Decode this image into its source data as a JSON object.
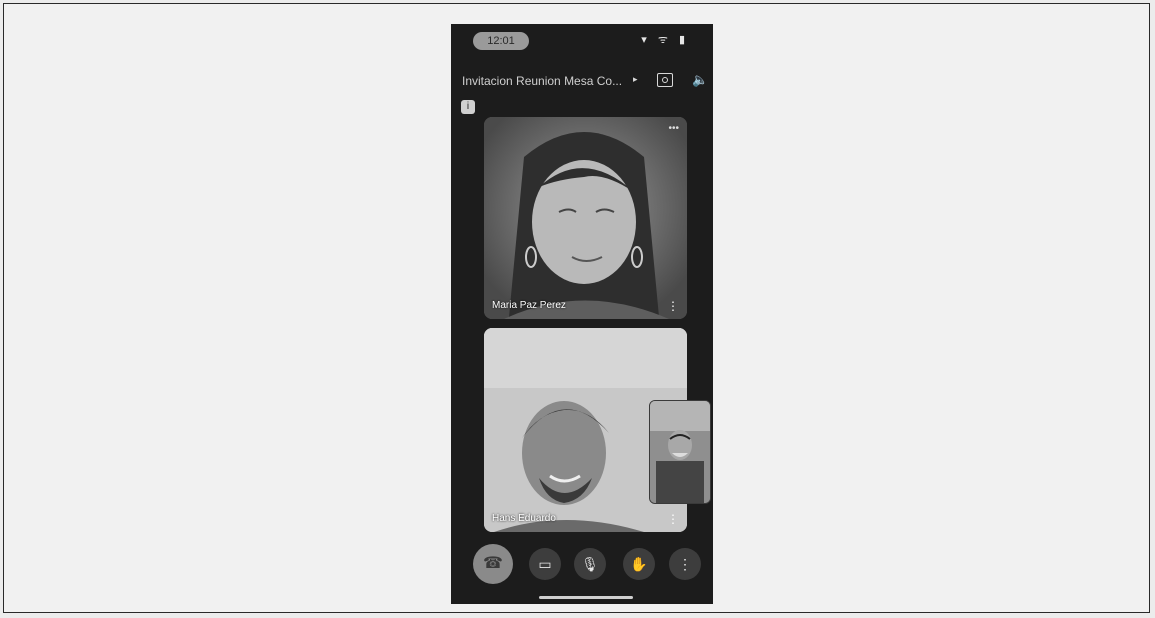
{
  "status_bar": {
    "time": "12:01",
    "icons": "▾ ᯤ ▮"
  },
  "header": {
    "meeting_title": "Invitacion Reunion Mesa Co...",
    "chevron": "▸",
    "speaker": "🔈"
  },
  "info_icon": "i",
  "participants": [
    {
      "name": "Maria Paz Perez",
      "more": "⋮",
      "options": "•••"
    },
    {
      "name": "Hans Eduardo",
      "more": "⋮"
    }
  ],
  "toolbar": {
    "end_call": "☎",
    "camera": "▭",
    "mic": "🎙",
    "raise_hand": "✋",
    "more": "⋮"
  },
  "colors": {
    "phone_bg": "#1c1c1c",
    "end_call_bg": "#8a8a8a"
  }
}
